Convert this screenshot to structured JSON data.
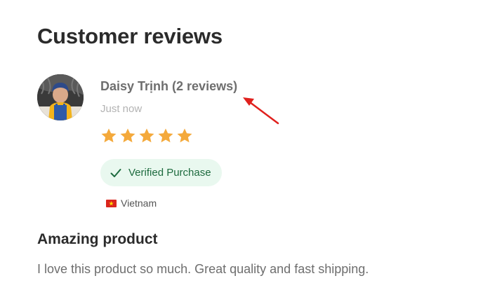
{
  "section": {
    "title": "Customer reviews"
  },
  "review": {
    "reviewer_name": "Daisy Trịnh (2 reviews)",
    "time": "Just now",
    "rating": 5,
    "rating_max": 5,
    "verified_label": "Verified Purchase",
    "country": "Vietnam",
    "title": "Amazing product",
    "body": "I love this product so much. Great quality and fast shipping."
  },
  "colors": {
    "star": "#f4a93b",
    "verified_bg": "#e9f8ef",
    "verified_text": "#1e6b3f",
    "annotation": "#e0201d"
  },
  "icons": {
    "check": "check-icon",
    "flag": "vietnam-flag-icon",
    "star": "star-icon"
  }
}
